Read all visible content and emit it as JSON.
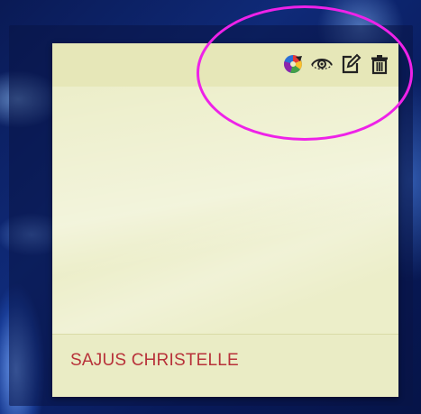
{
  "card": {
    "owner_name": "SAJUS CHRISTELLE",
    "header_color": "#e6e7b8",
    "body_color": "#eceec9",
    "name_color": "#b8323a"
  },
  "toolbar": {
    "icons": [
      "color-wheel-icon",
      "eye-icon",
      "edit-icon",
      "trash-icon"
    ]
  },
  "annotation": {
    "highlight_color": "#ee22e8"
  }
}
